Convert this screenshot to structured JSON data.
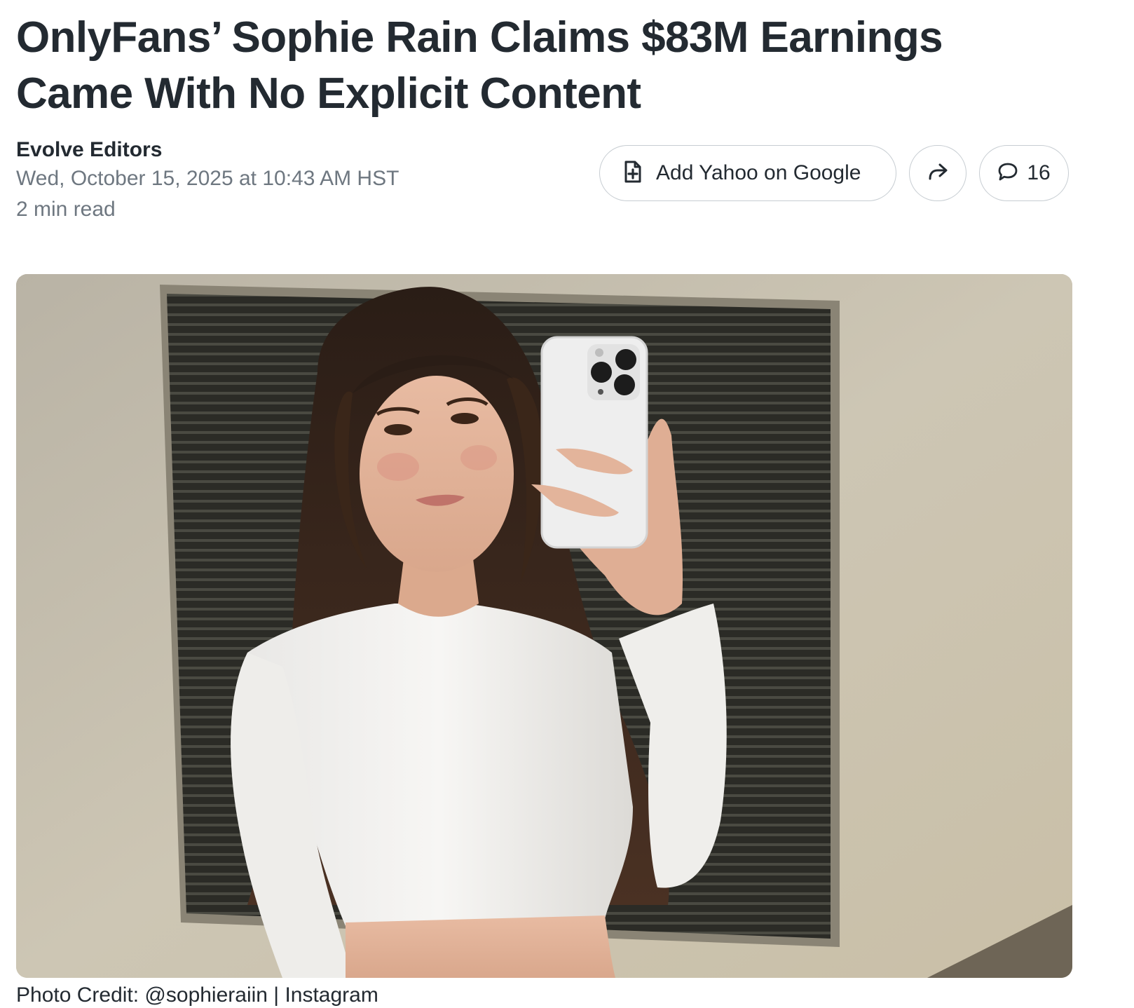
{
  "article": {
    "headline": "OnlyFans’ Sophie Rain Claims $83M Earnings Came With No Explicit Content",
    "author": "Evolve Editors",
    "published": "Wed, October 15, 2025 at 10:43 AM HST",
    "read_time": "2 min read"
  },
  "actions": {
    "add_google_label": "Add Yahoo on Google",
    "add_google_icon": "document-plus-icon",
    "share_icon": "share-arrow-icon",
    "comments_icon": "speech-bubble-icon",
    "comment_count": "16"
  },
  "image": {
    "credit": "Photo Credit: @sophieraiin | Instagram"
  },
  "colors": {
    "text": "#232a31",
    "meta": "#6e7780",
    "border": "#c7cdd2"
  }
}
